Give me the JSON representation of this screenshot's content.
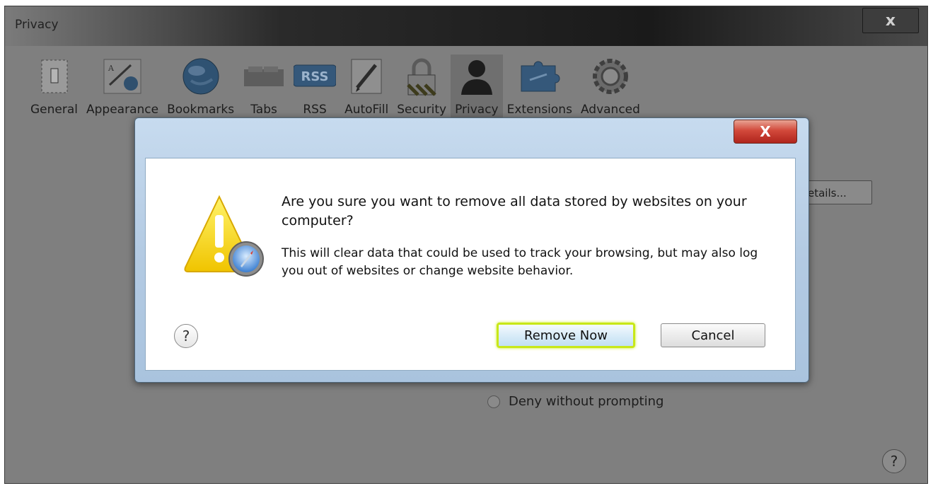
{
  "background_window": {
    "title": "Privacy",
    "close_label": "x",
    "toolbar": [
      {
        "label": "General",
        "icon": "general-switch-icon"
      },
      {
        "label": "Appearance",
        "icon": "appearance-icon"
      },
      {
        "label": "Bookmarks",
        "icon": "globe-icon"
      },
      {
        "label": "Tabs",
        "icon": "tabs-icon"
      },
      {
        "label": "RSS",
        "icon": "rss-icon"
      },
      {
        "label": "AutoFill",
        "icon": "autofill-pencil-icon"
      },
      {
        "label": "Security",
        "icon": "lock-icon"
      },
      {
        "label": "Privacy",
        "icon": "person-silhouette-icon"
      },
      {
        "label": "Extensions",
        "icon": "puzzle-icon"
      },
      {
        "label": "Advanced",
        "icon": "gear-icon"
      }
    ],
    "selected_tab": "Privacy",
    "details_button_label": "etails...",
    "radio_label": "Deny without prompting",
    "help_label": "?"
  },
  "dialog": {
    "close_label": "X",
    "message": "Are you sure you want to remove all data stored by websites on your computer?",
    "detail": "This will clear data that could be used to track your browsing, but may also log you out of websites or change website behavior.",
    "help_label": "?",
    "primary_button": "Remove Now",
    "secondary_button": "Cancel",
    "highlight_color": "#c8e818"
  }
}
